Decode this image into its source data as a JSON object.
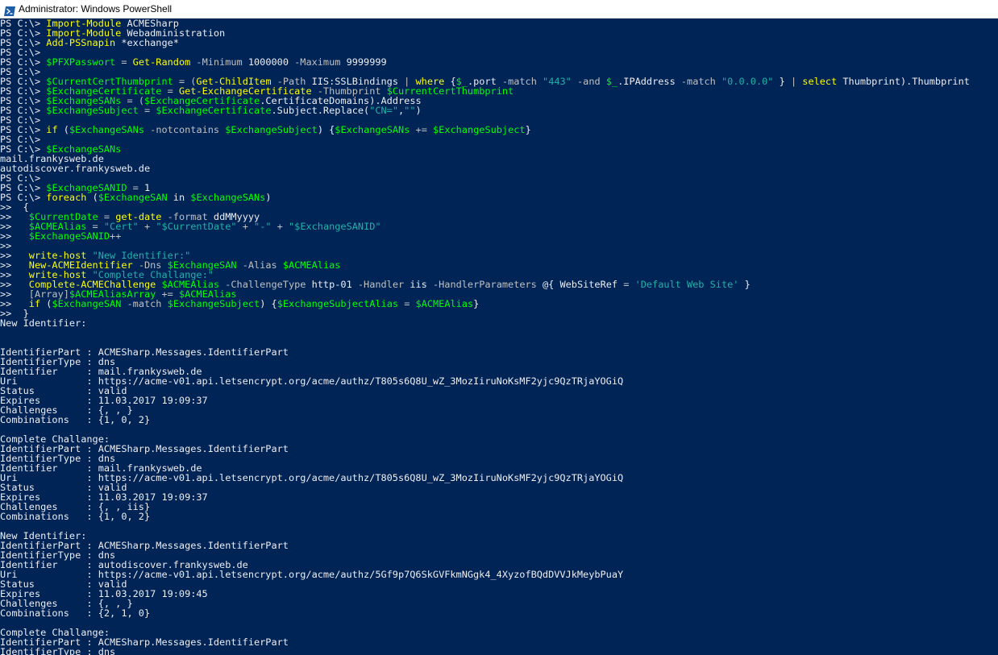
{
  "window": {
    "title": "Administrator: Windows PowerShell",
    "icon": "powershell-icon"
  },
  "colors": {
    "background": "#012456",
    "default": "#eeedf0",
    "command": "#fefe00",
    "variable": "#00ff00",
    "parameter": "#c0c0c0",
    "string": "#20b2aa",
    "operator": "#c0c0c0"
  },
  "console": {
    "lines": [
      [
        [
          "PS C:\\> ",
          "d"
        ],
        [
          "Import-Module",
          "c"
        ],
        [
          " ACMESharp",
          "d"
        ]
      ],
      [
        [
          "PS C:\\> ",
          "d"
        ],
        [
          "Import-Module",
          "c"
        ],
        [
          " Webadministration",
          "d"
        ]
      ],
      [
        [
          "PS C:\\> ",
          "d"
        ],
        [
          "Add-PSSnapin",
          "c"
        ],
        [
          " *exchange*",
          "d"
        ]
      ],
      [
        [
          "PS C:\\>",
          "d"
        ]
      ],
      [
        [
          "PS C:\\> ",
          "d"
        ],
        [
          "$PFXPasswort",
          "v"
        ],
        [
          " = ",
          "o"
        ],
        [
          "Get-Random",
          "c"
        ],
        [
          " -Minimum",
          "p"
        ],
        [
          " 1000000",
          "d"
        ],
        [
          " -Maximum",
          "p"
        ],
        [
          " 9999999",
          "d"
        ]
      ],
      [
        [
          "PS C:\\>",
          "d"
        ]
      ],
      [
        [
          "PS C:\\> ",
          "d"
        ],
        [
          "$CurrentCertThumbprint",
          "v"
        ],
        [
          " = (",
          "o"
        ],
        [
          "Get-ChildItem",
          "c"
        ],
        [
          " -Path",
          "p"
        ],
        [
          " IIS:SSLBindings ",
          "d"
        ],
        [
          "|",
          "o"
        ],
        [
          " ",
          "d"
        ],
        [
          "where",
          "c"
        ],
        [
          " {",
          "d"
        ],
        [
          "$_",
          "v"
        ],
        [
          ".port ",
          "d"
        ],
        [
          "-match",
          "p"
        ],
        [
          " ",
          "d"
        ],
        [
          "\"443\"",
          "s"
        ],
        [
          " ",
          "d"
        ],
        [
          "-and",
          "p"
        ],
        [
          " ",
          "d"
        ],
        [
          "$_",
          "v"
        ],
        [
          ".IPAddress ",
          "d"
        ],
        [
          "-match",
          "p"
        ],
        [
          " ",
          "d"
        ],
        [
          "\"0.0.0.0\"",
          "s"
        ],
        [
          " } ",
          "d"
        ],
        [
          "|",
          "o"
        ],
        [
          " ",
          "d"
        ],
        [
          "select",
          "c"
        ],
        [
          " Thumbprint).Thumbprint",
          "d"
        ]
      ],
      [
        [
          "PS C:\\> ",
          "d"
        ],
        [
          "$ExchangeCertificate",
          "v"
        ],
        [
          " = ",
          "o"
        ],
        [
          "Get-ExchangeCertificate",
          "c"
        ],
        [
          " -Thumbprint",
          "p"
        ],
        [
          " ",
          "d"
        ],
        [
          "$CurrentCertThumbprint",
          "v"
        ]
      ],
      [
        [
          "PS C:\\> ",
          "d"
        ],
        [
          "$ExchangeSANs",
          "v"
        ],
        [
          " = (",
          "o"
        ],
        [
          "$ExchangeCertificate",
          "v"
        ],
        [
          ".CertificateDomains).Address",
          "d"
        ]
      ],
      [
        [
          "PS C:\\> ",
          "d"
        ],
        [
          "$ExchangeSubject",
          "v"
        ],
        [
          " = ",
          "o"
        ],
        [
          "$ExchangeCertificate",
          "v"
        ],
        [
          ".Subject.Replace(",
          "d"
        ],
        [
          "\"CN=\"",
          "s"
        ],
        [
          ",",
          "d"
        ],
        [
          "\"\"",
          "s"
        ],
        [
          ")",
          "d"
        ]
      ],
      [
        [
          "PS C:\\>",
          "d"
        ]
      ],
      [
        [
          "PS C:\\> ",
          "d"
        ],
        [
          "if",
          "c"
        ],
        [
          " (",
          "d"
        ],
        [
          "$ExchangeSANs",
          "v"
        ],
        [
          " -notcontains",
          "p"
        ],
        [
          " ",
          "d"
        ],
        [
          "$ExchangeSubject",
          "v"
        ],
        [
          ") {",
          "d"
        ],
        [
          "$ExchangeSANs",
          "v"
        ],
        [
          " += ",
          "o"
        ],
        [
          "$ExchangeSubject",
          "v"
        ],
        [
          "}",
          "d"
        ]
      ],
      [
        [
          "PS C:\\>",
          "d"
        ]
      ],
      [
        [
          "PS C:\\> ",
          "d"
        ],
        [
          "$ExchangeSANs",
          "v"
        ]
      ],
      [
        [
          "mail.frankysweb.de",
          "d"
        ]
      ],
      [
        [
          "autodiscover.frankysweb.de",
          "d"
        ]
      ],
      [
        [
          "PS C:\\>",
          "d"
        ]
      ],
      [
        [
          "PS C:\\> ",
          "d"
        ],
        [
          "$ExchangeSANID",
          "v"
        ],
        [
          " = ",
          "o"
        ],
        [
          "1",
          "d"
        ]
      ],
      [
        [
          "PS C:\\> ",
          "d"
        ],
        [
          "foreach",
          "c"
        ],
        [
          " (",
          "d"
        ],
        [
          "$ExchangeSAN",
          "v"
        ],
        [
          " in ",
          "d"
        ],
        [
          "$ExchangeSANs",
          "v"
        ],
        [
          ")",
          "d"
        ]
      ],
      [
        [
          ">>  {",
          "d"
        ]
      ],
      [
        [
          ">>   ",
          "d"
        ],
        [
          "$CurrentDate",
          "v"
        ],
        [
          " = ",
          "o"
        ],
        [
          "get-date",
          "c"
        ],
        [
          " -format",
          "p"
        ],
        [
          " ddMMyyyy",
          "d"
        ]
      ],
      [
        [
          ">>   ",
          "d"
        ],
        [
          "$ACMEAlias",
          "v"
        ],
        [
          " = ",
          "o"
        ],
        [
          "\"Cert\"",
          "s"
        ],
        [
          " + ",
          "o"
        ],
        [
          "\"$CurrentDate\"",
          "s"
        ],
        [
          " + ",
          "o"
        ],
        [
          "\"-\"",
          "s"
        ],
        [
          " + ",
          "o"
        ],
        [
          "\"$ExchangeSANID\"",
          "s"
        ]
      ],
      [
        [
          ">>   ",
          "d"
        ],
        [
          "$ExchangeSANID",
          "v"
        ],
        [
          "++",
          "o"
        ]
      ],
      [
        [
          ">>",
          "d"
        ]
      ],
      [
        [
          ">>   ",
          "d"
        ],
        [
          "write-host",
          "c"
        ],
        [
          " ",
          "d"
        ],
        [
          "\"New Identifier:\"",
          "s"
        ]
      ],
      [
        [
          ">>   ",
          "d"
        ],
        [
          "New-ACMEIdentifier",
          "c"
        ],
        [
          " -Dns",
          "p"
        ],
        [
          " ",
          "d"
        ],
        [
          "$ExchangeSAN",
          "v"
        ],
        [
          " -Alias",
          "p"
        ],
        [
          " ",
          "d"
        ],
        [
          "$ACMEAlias",
          "v"
        ]
      ],
      [
        [
          ">>   ",
          "d"
        ],
        [
          "write-host",
          "c"
        ],
        [
          " ",
          "d"
        ],
        [
          "\"Complete Challange:\"",
          "s"
        ]
      ],
      [
        [
          ">>   ",
          "d"
        ],
        [
          "Complete-ACMEChallenge",
          "c"
        ],
        [
          " ",
          "d"
        ],
        [
          "$ACMEAlias",
          "v"
        ],
        [
          " -ChallengeType",
          "p"
        ],
        [
          " http-01 ",
          "d"
        ],
        [
          "-Handler",
          "p"
        ],
        [
          " iis ",
          "d"
        ],
        [
          "-HandlerParameters",
          "p"
        ],
        [
          " @{ WebSiteRef ",
          "d"
        ],
        [
          "=",
          "o"
        ],
        [
          " ",
          "d"
        ],
        [
          "'Default Web Site'",
          "s"
        ],
        [
          " }",
          "d"
        ]
      ],
      [
        [
          ">>   ",
          "d"
        ],
        [
          "[Array]",
          "p"
        ],
        [
          "$ACMEAliasArray",
          "v"
        ],
        [
          " += ",
          "o"
        ],
        [
          "$ACMEAlias",
          "v"
        ]
      ],
      [
        [
          ">>   ",
          "d"
        ],
        [
          "if",
          "c"
        ],
        [
          " (",
          "d"
        ],
        [
          "$ExchangeSAN",
          "v"
        ],
        [
          " -match",
          "p"
        ],
        [
          " ",
          "d"
        ],
        [
          "$ExchangeSubject",
          "v"
        ],
        [
          ") {",
          "d"
        ],
        [
          "$ExchangeSubjectAlias",
          "v"
        ],
        [
          " = ",
          "o"
        ],
        [
          "$ACMEAlias",
          "v"
        ],
        [
          "}",
          "d"
        ]
      ],
      [
        [
          ">>  }",
          "d"
        ]
      ],
      [
        [
          "New Identifier:",
          "d"
        ]
      ],
      [
        [
          "",
          "d"
        ]
      ],
      [
        [
          "",
          "d"
        ]
      ],
      [
        [
          "IdentifierPart : ACMESharp.Messages.IdentifierPart",
          "d"
        ]
      ],
      [
        [
          "IdentifierType : dns",
          "d"
        ]
      ],
      [
        [
          "Identifier     : mail.frankysweb.de",
          "d"
        ]
      ],
      [
        [
          "Uri            : https://acme-v01.api.letsencrypt.org/acme/authz/T805s6Q8U_wZ_3MozIiruNoKsMF2yjc9QzTRjaYOGiQ",
          "d"
        ]
      ],
      [
        [
          "Status         : valid",
          "d"
        ]
      ],
      [
        [
          "Expires        : 11.03.2017 19:09:37",
          "d"
        ]
      ],
      [
        [
          "Challenges     : {, , }",
          "d"
        ]
      ],
      [
        [
          "Combinations   : {1, 0, 2}",
          "d"
        ]
      ],
      [
        [
          "",
          "d"
        ]
      ],
      [
        [
          "Complete Challange:",
          "d"
        ]
      ],
      [
        [
          "IdentifierPart : ACMESharp.Messages.IdentifierPart",
          "d"
        ]
      ],
      [
        [
          "IdentifierType : dns",
          "d"
        ]
      ],
      [
        [
          "Identifier     : mail.frankysweb.de",
          "d"
        ]
      ],
      [
        [
          "Uri            : https://acme-v01.api.letsencrypt.org/acme/authz/T805s6Q8U_wZ_3MozIiruNoKsMF2yjc9QzTRjaYOGiQ",
          "d"
        ]
      ],
      [
        [
          "Status         : valid",
          "d"
        ]
      ],
      [
        [
          "Expires        : 11.03.2017 19:09:37",
          "d"
        ]
      ],
      [
        [
          "Challenges     : {, , iis}",
          "d"
        ]
      ],
      [
        [
          "Combinations   : {1, 0, 2}",
          "d"
        ]
      ],
      [
        [
          "",
          "d"
        ]
      ],
      [
        [
          "New Identifier:",
          "d"
        ]
      ],
      [
        [
          "IdentifierPart : ACMESharp.Messages.IdentifierPart",
          "d"
        ]
      ],
      [
        [
          "IdentifierType : dns",
          "d"
        ]
      ],
      [
        [
          "Identifier     : autodiscover.frankysweb.de",
          "d"
        ]
      ],
      [
        [
          "Uri            : https://acme-v01.api.letsencrypt.org/acme/authz/5Gf9p7Q6SkGVFkmNGgk4_4XyzofBQdDVVJkMeybPuaY",
          "d"
        ]
      ],
      [
        [
          "Status         : valid",
          "d"
        ]
      ],
      [
        [
          "Expires        : 11.03.2017 19:09:45",
          "d"
        ]
      ],
      [
        [
          "Challenges     : {, , }",
          "d"
        ]
      ],
      [
        [
          "Combinations   : {2, 1, 0}",
          "d"
        ]
      ],
      [
        [
          "",
          "d"
        ]
      ],
      [
        [
          "Complete Challange:",
          "d"
        ]
      ],
      [
        [
          "IdentifierPart : ACMESharp.Messages.IdentifierPart",
          "d"
        ]
      ],
      [
        [
          "IdentifierType : dns",
          "d"
        ]
      ]
    ]
  }
}
